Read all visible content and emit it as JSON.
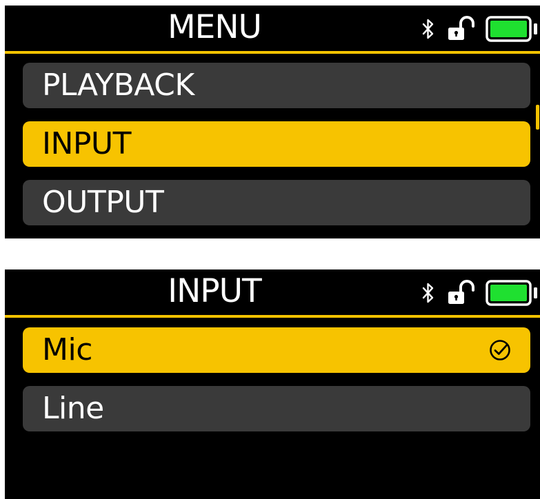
{
  "colors": {
    "accent": "#f7c300",
    "row_background": "#3a3a3a",
    "screen_background": "#000000",
    "battery_fill": "#1fe030"
  },
  "status_icons": [
    "bluetooth-icon",
    "unlocked-padlock-icon",
    "battery-full-icon"
  ],
  "screens": {
    "menu": {
      "title": "MENU",
      "items": [
        {
          "label": "PLAYBACK",
          "selected": false
        },
        {
          "label": "INPUT",
          "selected": true
        },
        {
          "label": "OUTPUT",
          "selected": false
        }
      ]
    },
    "input": {
      "title": "INPUT",
      "items": [
        {
          "label": "Mic",
          "selected": true,
          "checked": true
        },
        {
          "label": "Line",
          "selected": false,
          "checked": false
        }
      ]
    }
  }
}
